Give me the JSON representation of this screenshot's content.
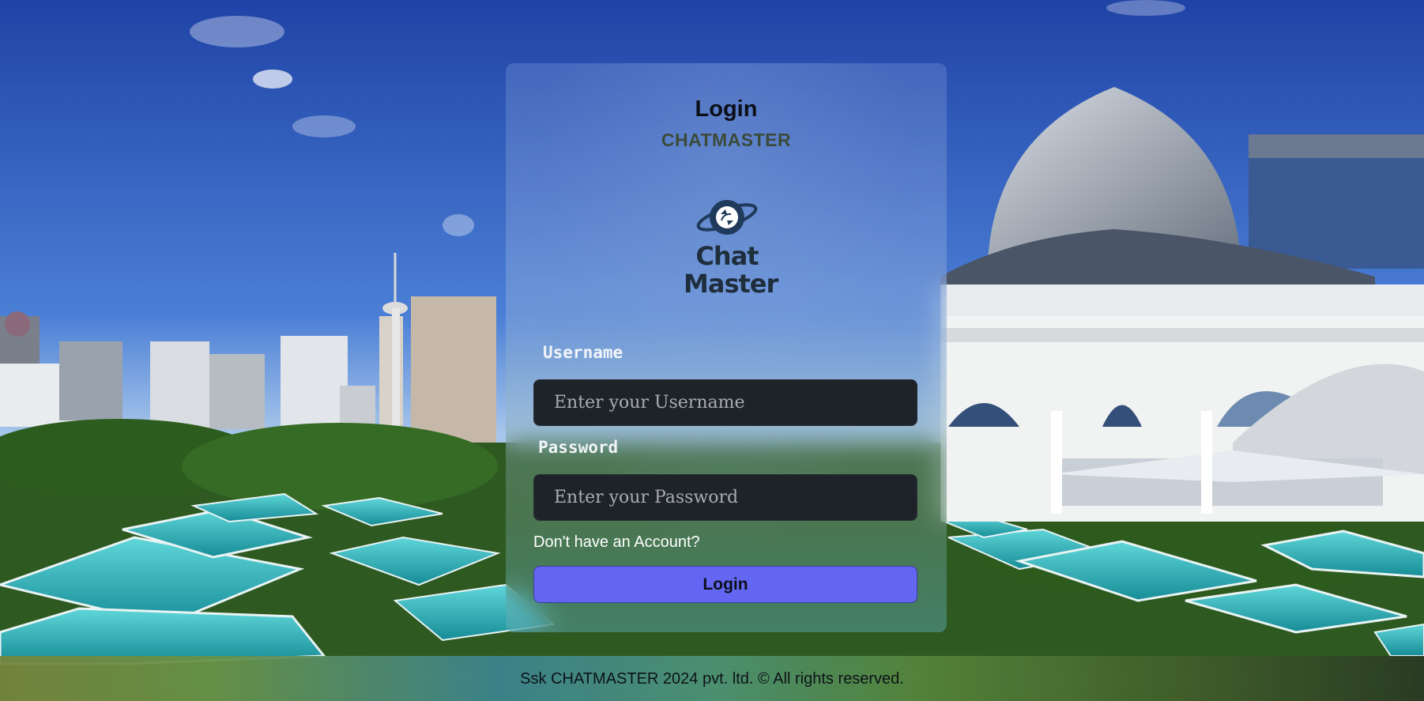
{
  "login": {
    "title": "Login",
    "brand": "CHATMASTER",
    "logo_line1": "Chat",
    "logo_line2": "Master",
    "logo_icon": "planet-chat-icon",
    "username_label": "Username",
    "username_placeholder": "Enter your Username",
    "username_value": "",
    "password_label": "Password",
    "password_placeholder": "Enter your Password",
    "password_value": "",
    "signup_link": "Don't have an Account?",
    "submit_label": "Login"
  },
  "footer": {
    "text": "Ssk CHATMASTER 2024 pvt. ltd. © All rights reserved."
  },
  "colors": {
    "button_bg": "#6366f1",
    "input_bg": "#1e2229",
    "brand_text": "#3b4b3a",
    "sky": "#2448a8"
  }
}
